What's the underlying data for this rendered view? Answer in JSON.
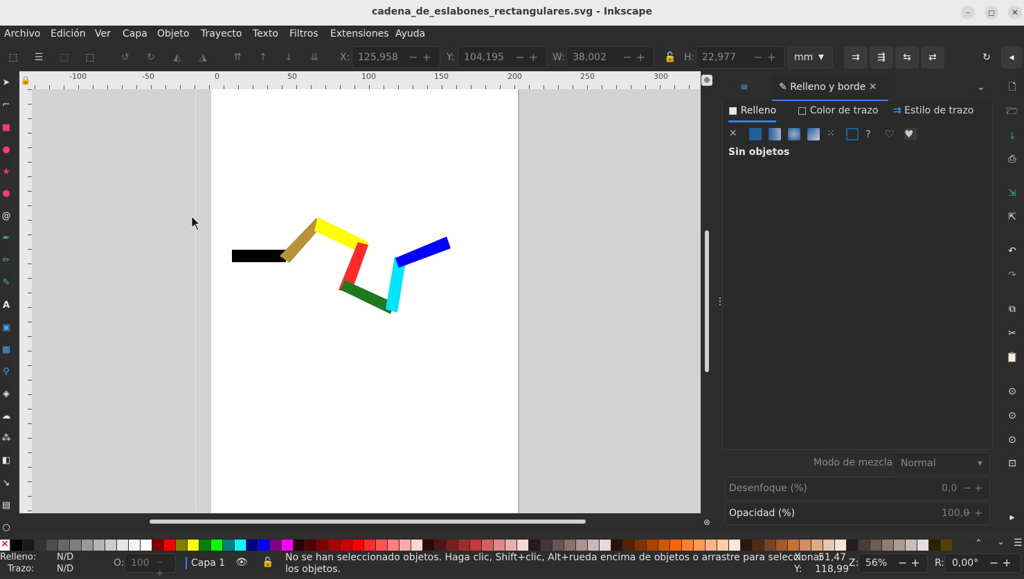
{
  "window": {
    "title": "cadena_de_eslabones_rectangulares.svg - Inkscape"
  },
  "menu": [
    "Archivo",
    "Edición",
    "Ver",
    "Capa",
    "Objeto",
    "Trayecto",
    "Texto",
    "Filtros",
    "Extensiones",
    "Ayuda"
  ],
  "toolbar": {
    "x_label": "X:",
    "x_value": "125,958",
    "y_label": "Y:",
    "y_value": "104,195",
    "w_label": "W:",
    "w_value": "38,002",
    "h_label": "H:",
    "h_value": "22,977",
    "unit": "mm"
  },
  "ruler": {
    "labels": [
      "-100",
      "-50",
      "0",
      "50",
      "100",
      "150",
      "200",
      "250",
      "300"
    ]
  },
  "drawing": {
    "links": [
      {
        "name": "black-link",
        "color": "#000000"
      },
      {
        "name": "tan-link",
        "color": "#b8913a"
      },
      {
        "name": "yellow-link",
        "color": "#ffff00"
      },
      {
        "name": "red-link",
        "color": "#ff2a2a"
      },
      {
        "name": "green-link",
        "color": "#1f7a1f"
      },
      {
        "name": "cyan-link",
        "color": "#00e5ff"
      },
      {
        "name": "blue-link",
        "color": "#0000ff"
      }
    ]
  },
  "dock": {
    "tab_label": "Relleno y borde",
    "subtabs": {
      "fill": "Relleno",
      "stroke_paint": "Color de trazo",
      "stroke_style": "Estilo de trazo"
    },
    "no_objects": "Sin objetos",
    "blend_label": "Modo de mezcla:",
    "blend_value": "Normal",
    "blur_label": "Desenfoque (%)",
    "blur_value": "0,0",
    "opacity_label": "Opacidad (%)",
    "opacity_value": "100,0"
  },
  "status": {
    "fill_label": "Relleno:",
    "fill_value": "N/D",
    "stroke_label": "Trazo:",
    "stroke_value": "N/D",
    "opacity_label": "O:",
    "opacity_value": "100",
    "layer": "Capa 1",
    "message_line1": "No se han seleccionado objetos. Haga clic, Shift+clic, Alt+rueda encima de objetos o arrastre para seleccionar",
    "message_line2": "los objetos.",
    "cursor_x_label": "X:",
    "cursor_x": "51,47",
    "cursor_y_label": "Y:",
    "cursor_y": "118,99",
    "zoom_label": "Z:",
    "zoom": "56%",
    "rotation_label": "R:",
    "rotation": "0,00°"
  },
  "palette": [
    "#000000",
    "#1a1a1a",
    "#333333",
    "#4d4d4d",
    "#666666",
    "#808080",
    "#999999",
    "#b3b3b3",
    "#cccccc",
    "#e6e6e6",
    "#f2f2f2",
    "#ffffff",
    "#800000",
    "#ff0000",
    "#808000",
    "#ffff00",
    "#008000",
    "#00ff00",
    "#008080",
    "#00ffff",
    "#000080",
    "#0000ff",
    "#800080",
    "#ff00ff",
    "#2b0000",
    "#550000",
    "#800000",
    "#aa0000",
    "#d40000",
    "#ff0000",
    "#ff2a2a",
    "#ff5555",
    "#ff8080",
    "#ffaaaa",
    "#ffd5d5",
    "#280b0b",
    "#501616",
    "#782121",
    "#a02c2c",
    "#c83737",
    "#d35f5f",
    "#de8787",
    "#e9afaf",
    "#f4d7d7",
    "#241c1c",
    "#483737",
    "#6c5353",
    "#916f6f",
    "#ac9393",
    "#c8b7b7",
    "#e3dbdb",
    "#2b1100",
    "#552200",
    "#803300",
    "#aa4400",
    "#d45500",
    "#ff6600",
    "#ff7f2a",
    "#ff9955",
    "#ffb380",
    "#ffccaa",
    "#ffe6d5",
    "#28170b",
    "#502d16",
    "#784421",
    "#a05a2c",
    "#c87137",
    "#d38d5f",
    "#deaa87",
    "#e9c6af",
    "#f4e3d7",
    "#241f1c",
    "#483e37",
    "#6c5d53",
    "#917c6f",
    "#ac9d93",
    "#c8beb7",
    "#e3dedb",
    "#2b2200",
    "#554400"
  ]
}
